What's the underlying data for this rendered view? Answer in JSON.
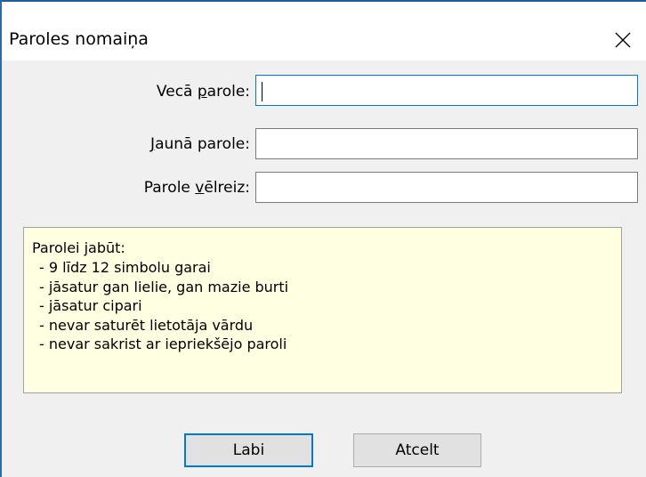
{
  "dialog": {
    "title": "Paroles nomaiņa",
    "close_icon": "close-icon"
  },
  "form": {
    "old_password": {
      "label_before": "Vecā ",
      "label_accel": "p",
      "label_after": "arole:",
      "value": ""
    },
    "new_password": {
      "label_before": "",
      "label_accel": "J",
      "label_after": "aunā parole:",
      "value": ""
    },
    "confirm_password": {
      "label_before": "Parole ",
      "label_accel": "v",
      "label_after": "ēlreiz:",
      "value": ""
    }
  },
  "requirements": {
    "title": "Parolei jabūt:",
    "items": [
      "- 9 līdz 12 simbolu garai",
      "- jāsatur gan lielie, gan mazie burti",
      "- jāsatur cipari",
      "- nevar saturēt lietotāja vārdu",
      "- nevar sakrist ar iepriekšējo paroli"
    ]
  },
  "buttons": {
    "ok": "Labi",
    "cancel": "Atcelt"
  },
  "colors": {
    "accent": "#0078d7",
    "info_background": "#ffffe1",
    "client_background": "#f0f0f0",
    "window_edge": "#2b6aab"
  }
}
